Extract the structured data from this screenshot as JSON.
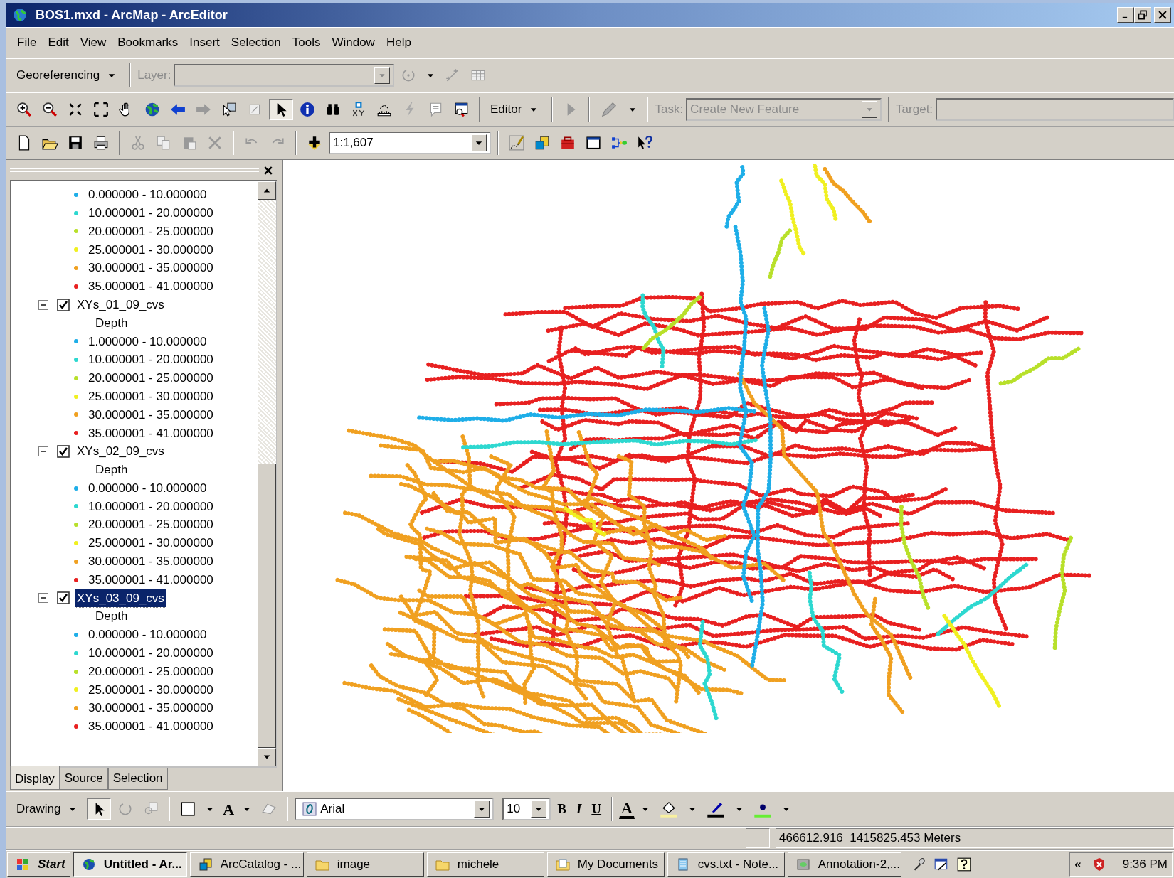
{
  "window": {
    "title": "BOS1.mxd - ArcMap - ArcEditor"
  },
  "menu": [
    "File",
    "Edit",
    "View",
    "Bookmarks",
    "Insert",
    "Selection",
    "Tools",
    "Window",
    "Help"
  ],
  "georeferencing_toolbar": {
    "menu": "Georeferencing",
    "layer_label": "Layer:",
    "disabled": true
  },
  "tools_toolbar": {
    "editor_menu": "Editor",
    "task_label": "Task:",
    "task_value": "Create New Feature",
    "target_label": "Target:",
    "disabled": true
  },
  "standard_toolbar": {
    "scale": "1:1,607"
  },
  "table_of_contents": {
    "layers": [
      {
        "legend": [
          {
            "label": "0.000000 - 10.000000",
            "color": "#1eaee8"
          },
          {
            "label": "10.000001 - 20.000000",
            "color": "#2dd8d0"
          },
          {
            "label": "20.000001 - 25.000000",
            "color": "#b8e02a"
          },
          {
            "label": "25.000001 - 30.000000",
            "color": "#f0f020"
          },
          {
            "label": "30.000001 - 35.000000",
            "color": "#f0a020"
          },
          {
            "label": "35.000001 - 41.000000",
            "color": "#e82020"
          }
        ]
      },
      {
        "name": "XYs_01_09_cvs",
        "checked": true,
        "expanded": true,
        "selected": false,
        "field": "Depth",
        "legend": [
          {
            "label": "1.000000 - 10.000000",
            "color": "#1eaee8"
          },
          {
            "label": "10.000001 - 20.000000",
            "color": "#2dd8d0"
          },
          {
            "label": "20.000001 - 25.000000",
            "color": "#b8e02a"
          },
          {
            "label": "25.000001 - 30.000000",
            "color": "#f0f020"
          },
          {
            "label": "30.000001 - 35.000000",
            "color": "#f0a020"
          },
          {
            "label": "35.000001 - 41.000000",
            "color": "#e82020"
          }
        ]
      },
      {
        "name": "XYs_02_09_cvs",
        "checked": true,
        "expanded": true,
        "selected": false,
        "field": "Depth",
        "legend": [
          {
            "label": "0.000000 - 10.000000",
            "color": "#1eaee8"
          },
          {
            "label": "10.000001 - 20.000000",
            "color": "#2dd8d0"
          },
          {
            "label": "20.000001 - 25.000000",
            "color": "#b8e02a"
          },
          {
            "label": "25.000001 - 30.000000",
            "color": "#f0f020"
          },
          {
            "label": "30.000001 - 35.000000",
            "color": "#f0a020"
          },
          {
            "label": "35.000001 - 41.000000",
            "color": "#e82020"
          }
        ]
      },
      {
        "name": "XYs_03_09_cvs",
        "checked": true,
        "expanded": true,
        "selected": true,
        "field": "Depth",
        "legend": [
          {
            "label": "0.000000 - 10.000000",
            "color": "#1eaee8"
          },
          {
            "label": "10.000001 - 20.000000",
            "color": "#2dd8d0"
          },
          {
            "label": "20.000001 - 25.000000",
            "color": "#b8e02a"
          },
          {
            "label": "25.000001 - 30.000000",
            "color": "#f0f020"
          },
          {
            "label": "30.000001 - 35.000000",
            "color": "#f0a020"
          },
          {
            "label": "35.000001 - 41.000000",
            "color": "#e82020"
          }
        ]
      }
    ],
    "tabs": [
      {
        "label": "Display",
        "selected": true
      },
      {
        "label": "Source",
        "selected": false
      },
      {
        "label": "Selection",
        "selected": false
      }
    ]
  },
  "drawing_toolbar": {
    "menu": "Drawing",
    "text_tool": "A",
    "font": "Arial",
    "font_size": "10",
    "format_buttons": [
      {
        "label": "B",
        "kind": "bold"
      },
      {
        "label": "I",
        "kind": "italic"
      },
      {
        "label": "U",
        "kind": "underline"
      }
    ],
    "font_color": "A"
  },
  "status_bar": {
    "coordinates": "466612.916  1415825.453 Meters"
  },
  "taskbar": {
    "start": "Start",
    "tasks": [
      {
        "label": "Untitled - Ar...",
        "selected": true
      },
      {
        "label": "ArcCatalog - ...",
        "selected": false
      },
      {
        "label": "image",
        "selected": false
      },
      {
        "label": "michele",
        "selected": false
      },
      {
        "label": "My Documents",
        "selected": false
      },
      {
        "label": "cvs.txt - Note...",
        "selected": false
      },
      {
        "label": "Annotation-2,...",
        "selected": false
      }
    ],
    "tray_expand": "«",
    "clock": "9:36 PM"
  }
}
